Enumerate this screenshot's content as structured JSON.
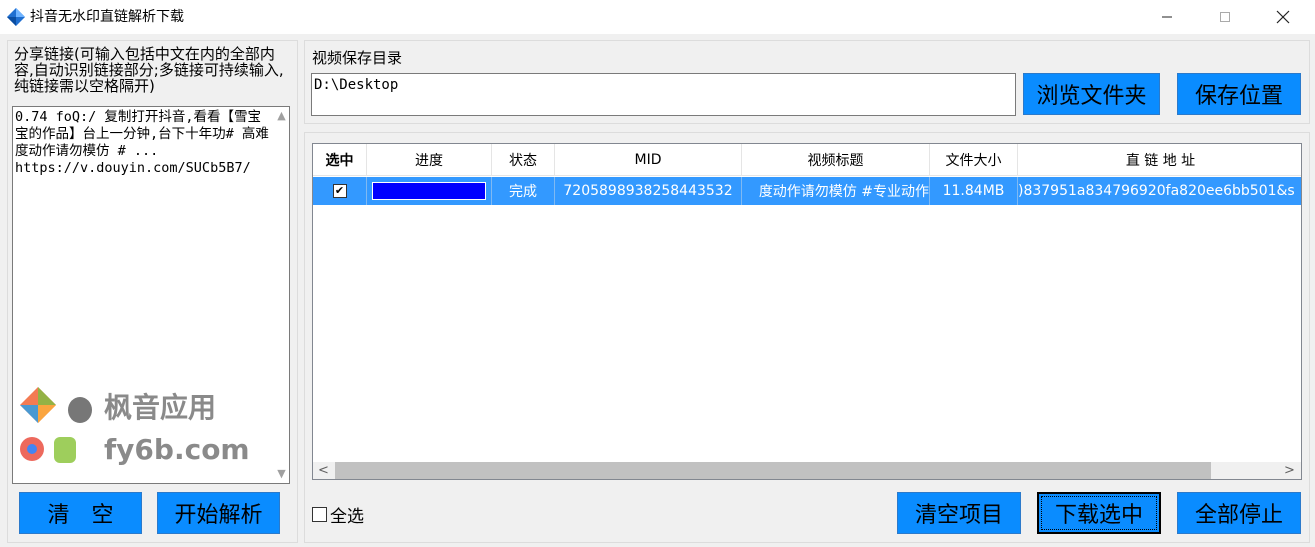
{
  "window": {
    "title": "抖音无水印直链解析下载",
    "controls": {
      "minimize": "—",
      "maximize": "☐",
      "close": "✕"
    }
  },
  "share": {
    "label": "分享链接(可输入包括中文在内的全部内容,自动识别链接部分;多链接可持续输入,纯链接需以空格隔开)",
    "text": "0.74 foQ:/ 复制打开抖音,看看【雪宝宝的作品】台上一分钟,台下十年功# 高难度动作请勿模仿 # ...\nhttps://v.douyin.com/SUCb5B7/",
    "scroll_up": "▲",
    "scroll_down": "▼"
  },
  "watermark": {
    "line1": "枫音应用",
    "line2": "fy6b.com"
  },
  "buttons": {
    "clear": "清空",
    "parse": "开始解析",
    "browse": "浏览文件夹",
    "save_location": "保存位置",
    "clear_items": "清空项目",
    "download_selected": "下载选中",
    "stop_all": "全部停止"
  },
  "save_dir": {
    "label": "视频保存目录",
    "value": "D:\\Desktop"
  },
  "table": {
    "columns": [
      "选中",
      "进度",
      "状态",
      "MID",
      "视频标题",
      "文件大小",
      "直 链 地 址"
    ],
    "rows": [
      {
        "checked": "✔",
        "progress": 100,
        "status": "完成",
        "mid": "7205898938258443532",
        "title": "度动作请勿模仿 #专业动作",
        "size": "11.84MB",
        "url": ")837951a834796920fa820ee6bb501&s"
      }
    ],
    "scroll_left": "<",
    "scroll_right": ">"
  },
  "select_all": {
    "label": "全选"
  },
  "colors": {
    "button": "#0a8cff",
    "selected_row": "#3399ff",
    "progress": "#0000ff"
  }
}
